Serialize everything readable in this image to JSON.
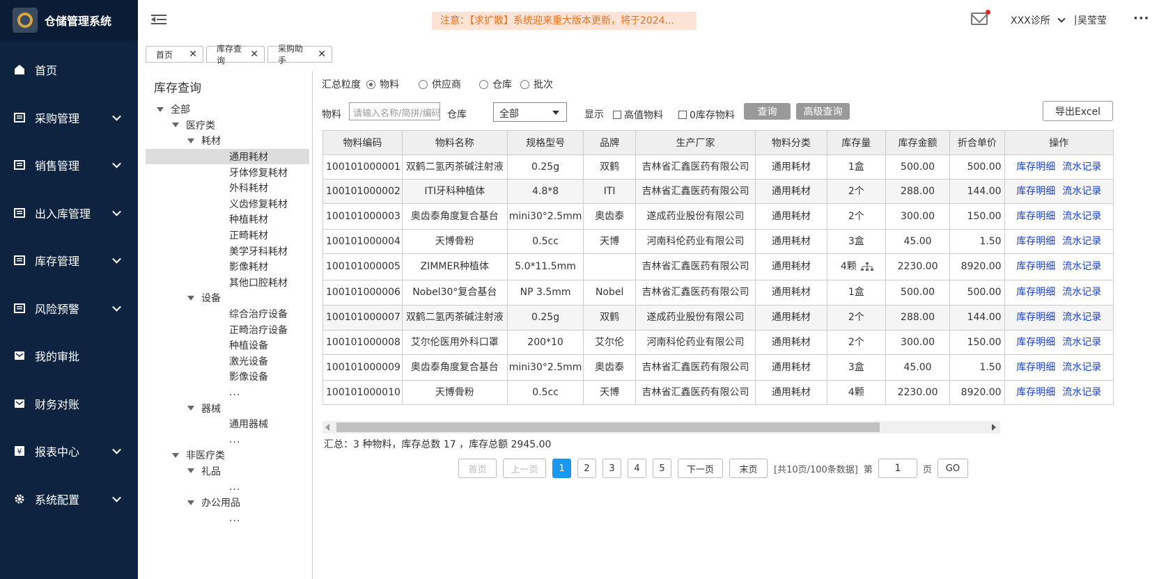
{
  "app": {
    "title": "仓储管理系统"
  },
  "sidebar": {
    "items": [
      {
        "label": "首页",
        "icon": "home-icon",
        "expandable": false
      },
      {
        "label": "采购管理",
        "icon": "list-icon",
        "expandable": true
      },
      {
        "label": "销售管理",
        "icon": "list-icon",
        "expandable": true
      },
      {
        "label": "出入库管理",
        "icon": "list-icon",
        "expandable": true
      },
      {
        "label": "库存管理",
        "icon": "list-icon",
        "expandable": true
      },
      {
        "label": "风险预警",
        "icon": "list-icon",
        "expandable": true
      },
      {
        "label": "我的审批",
        "icon": "mail-icon",
        "expandable": false
      },
      {
        "label": "财务对账",
        "icon": "mail-icon",
        "expandable": false
      },
      {
        "label": "报表中心",
        "icon": "yen-icon",
        "expandable": true
      },
      {
        "label": "系统配置",
        "icon": "gear-icon",
        "expandable": true
      }
    ]
  },
  "header": {
    "notice": "注意：【求扩散】系统迎来重大版本更新，将于2024...",
    "clinic": "XXX诊所",
    "separator": "|",
    "user": "吴莹莹",
    "more": "···"
  },
  "tabs": [
    {
      "label": "首页",
      "close": "✕"
    },
    {
      "label": "库存查询",
      "close": "✕"
    },
    {
      "label": "采购助手",
      "close": "✕"
    }
  ],
  "tree": {
    "title": "库存查询",
    "nodes": [
      {
        "label": "全部",
        "level": 1,
        "caret": true
      },
      {
        "label": "医疗类",
        "level": 2,
        "caret": true
      },
      {
        "label": "耗材",
        "level": 3,
        "caret": true
      },
      {
        "label": "通用耗材",
        "level": 4,
        "selected": true
      },
      {
        "label": "牙体修复耗材",
        "level": 4
      },
      {
        "label": "外科耗材",
        "level": 4
      },
      {
        "label": "义齿修复耗材",
        "level": 4
      },
      {
        "label": "种植耗材",
        "level": 4
      },
      {
        "label": "正畸耗材",
        "level": 4
      },
      {
        "label": "美学牙科耗材",
        "level": 4
      },
      {
        "label": "影像耗材",
        "level": 4
      },
      {
        "label": "其他口腔耗材",
        "level": 4
      },
      {
        "label": "设备",
        "level": 3,
        "caret": true
      },
      {
        "label": "综合治疗设备",
        "level": 4
      },
      {
        "label": "正畸治疗设备",
        "level": 4
      },
      {
        "label": "种植设备",
        "level": 4
      },
      {
        "label": "激光设备",
        "level": 4
      },
      {
        "label": "影像设备",
        "level": 4
      },
      {
        "label": "...",
        "level": 4
      },
      {
        "label": "器械",
        "level": 3,
        "caret": true
      },
      {
        "label": "通用器械",
        "level": 4
      },
      {
        "label": "...",
        "level": 4
      },
      {
        "label": "非医疗类",
        "level": 2,
        "caret": true
      },
      {
        "label": "礼品",
        "level": 3,
        "caret": true
      },
      {
        "label": "...",
        "level": 4
      },
      {
        "label": "办公用品",
        "level": 3,
        "caret": true
      },
      {
        "label": "...",
        "level": 4
      }
    ]
  },
  "filters": {
    "granularity_label": "汇总粒度",
    "granularity_options": [
      "物料",
      "供应商",
      "仓库",
      "批次"
    ],
    "granularity_selected": "物料",
    "material_label": "物料",
    "material_placeholder": "请输入名称/简拼/编码",
    "warehouse_label": "仓库",
    "warehouse_value": "全部",
    "display_label": "显示",
    "high_value_label": "高值物料",
    "zero_stock_label": "0库存物料",
    "query_button": "查询",
    "advanced_query_button": "高级查询",
    "export_button": "导出Excel"
  },
  "table": {
    "headers": [
      "物料编码",
      "物料名称",
      "规格型号",
      "品牌",
      "生产厂家",
      "物料分类",
      "库存量",
      "库存金额",
      "折合单价",
      "操作"
    ],
    "action_detail": "库存明细",
    "action_flow": "流水记录",
    "rows": [
      {
        "code": "100101000001",
        "name": "双鹤二氢丙茶碱注射液",
        "spec": "0.25g",
        "brand": "双鹤",
        "maker": "吉林省汇鑫医药有限公司",
        "category": "通用耗材",
        "qty": "1盒",
        "amount": "500.00",
        "unit_price": "500.00"
      },
      {
        "code": "100101000002",
        "name": "ITI牙科种植体",
        "spec": "4.8*8",
        "brand": "ITI",
        "maker": "吉林省汇鑫医药有限公司",
        "category": "通用耗材",
        "qty": "2个",
        "amount": "288.00",
        "unit_price": "144.00"
      },
      {
        "code": "100101000003",
        "name": "奥齿泰角度复合基台",
        "spec": "mini30°2.5mm",
        "brand": "奥齿泰",
        "maker": "遂成药业股份有限公司",
        "category": "通用耗材",
        "qty": "2个",
        "amount": "300.00",
        "unit_price": "150.00"
      },
      {
        "code": "100101000004",
        "name": "天博骨粉",
        "spec": "0.5cc",
        "brand": "天博",
        "maker": "河南科伦药业有限公司",
        "category": "通用耗材",
        "qty": "3盒",
        "amount": "45.00",
        "unit_price": "1.50"
      },
      {
        "code": "100101000005",
        "name": "ZIMMER种植体",
        "spec": "5.0*11.5mm",
        "brand": "",
        "maker": "吉林省汇鑫医药有限公司",
        "category": "通用耗材",
        "qty": "4颗",
        "amount": "2230.00",
        "unit_price": "8920.00",
        "branch_icon": true
      },
      {
        "code": "100101000006",
        "name": "Nobel30°复合基台",
        "spec": "NP 3.5mm",
        "brand": "Nobel",
        "maker": "吉林省汇鑫医药有限公司",
        "category": "通用耗材",
        "qty": "1盒",
        "amount": "500.00",
        "unit_price": "500.00"
      },
      {
        "code": "100101000007",
        "name": "双鹤二氢丙茶碱注射液",
        "spec": "0.25g",
        "brand": "双鹤",
        "maker": "遂成药业股份有限公司",
        "category": "通用耗材",
        "qty": "2个",
        "amount": "288.00",
        "unit_price": "144.00"
      },
      {
        "code": "100101000008",
        "name": "艾尔伦医用外科口罩",
        "spec": "200*10",
        "brand": "艾尔伦",
        "maker": "河南科伦药业有限公司",
        "category": "通用耗材",
        "qty": "2个",
        "amount": "300.00",
        "unit_price": "150.00"
      },
      {
        "code": "100101000009",
        "name": "奥齿泰角度复合基台",
        "spec": "mini30°2.5mm",
        "brand": "奥齿泰",
        "maker": "吉林省汇鑫医药有限公司",
        "category": "通用耗材",
        "qty": "3盒",
        "amount": "45.00",
        "unit_price": "1.50"
      },
      {
        "code": "100101000010",
        "name": "天博骨粉",
        "spec": "0.5cc",
        "brand": "天博",
        "maker": "吉林省汇鑫医药有限公司",
        "category": "通用耗材",
        "qty": "4颗",
        "amount": "2230.00",
        "unit_price": "8920.00"
      }
    ]
  },
  "summary": "汇总：3 种物料，库存总数 17 ，库存总额 2945.00",
  "pagination": {
    "first": "首页",
    "prev": "上一页",
    "pages": [
      "1",
      "2",
      "3",
      "4",
      "5"
    ],
    "current": "1",
    "next": "下一页",
    "last": "末页",
    "info": "[共10页/100条数据]",
    "goto_prefix": "第",
    "goto_value": "1",
    "goto_suffix": "页",
    "go": "GO"
  },
  "colors": {
    "sidebar_bg": "#0e2340",
    "notice_bg": "#fde2d6",
    "notice_text": "#e8721d",
    "link": "#1a3fc9",
    "page_active": "#1a98ef"
  }
}
